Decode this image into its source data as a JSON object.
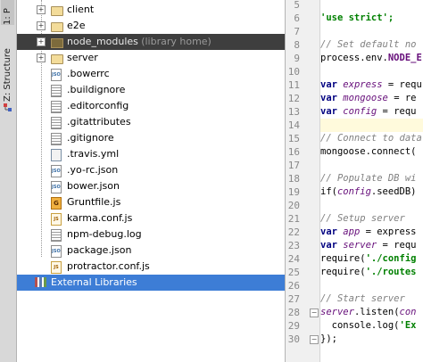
{
  "tool_strip": {
    "project_tab": "1: P",
    "structure_tab": "Z: Structure"
  },
  "tree": {
    "items": [
      {
        "label": "client",
        "kind": "folder",
        "expandable": true
      },
      {
        "label": "e2e",
        "kind": "folder",
        "expandable": true
      },
      {
        "label": "node_modules",
        "suffix": "(library home)",
        "kind": "folder-dark",
        "expandable": true
      },
      {
        "label": "server",
        "kind": "folder",
        "expandable": true
      },
      {
        "label": ".bowerrc",
        "kind": "json",
        "icon_text": "JSON"
      },
      {
        "label": ".buildignore",
        "kind": "text"
      },
      {
        "label": ".editorconfig",
        "kind": "text"
      },
      {
        "label": ".gitattributes",
        "kind": "text"
      },
      {
        "label": ".gitignore",
        "kind": "text"
      },
      {
        "label": ".travis.yml",
        "kind": "yml"
      },
      {
        "label": ".yo-rc.json",
        "kind": "json",
        "icon_text": "JSON"
      },
      {
        "label": "bower.json",
        "kind": "json",
        "icon_text": "JSON"
      },
      {
        "label": "Gruntfile.js",
        "kind": "grunt",
        "icon_text": "G"
      },
      {
        "label": "karma.conf.js",
        "kind": "js",
        "icon_text": "JS"
      },
      {
        "label": "npm-debug.log",
        "kind": "text"
      },
      {
        "label": "package.json",
        "kind": "json",
        "icon_text": "JSON"
      },
      {
        "label": "protractor.conf.js",
        "kind": "js",
        "icon_text": "JS"
      },
      {
        "label": "External Libraries",
        "kind": "libraries"
      }
    ]
  },
  "editor": {
    "line_numbers": [
      "5",
      "6",
      "7",
      "8",
      "9",
      "10",
      "11",
      "12",
      "13",
      "14",
      "15",
      "16",
      "17",
      "18",
      "19",
      "20",
      "21",
      "22",
      "23",
      "24",
      "25",
      "26",
      "27",
      "28",
      "29",
      "30"
    ],
    "current_line": "13",
    "code": {
      "l6": "'use strict';",
      "l8": "// Set default no",
      "l9_a": "process.env.",
      "l9_b": "NODE_E",
      "l11_kw": "var ",
      "l11_var": "express",
      "l11_rest": " = requ",
      "l12_kw": "var ",
      "l12_var": "mongoose",
      "l12_rest": " = re",
      "l13_kw": "var ",
      "l13_var": "config",
      "l13_rest": " = requ",
      "l15": "// Connect to data",
      "l16": "mongoose.connect(",
      "l18": "// Populate DB wi",
      "l19_a": "if(",
      "l19_b": "config",
      "l19_c": ".seedDB)",
      "l21": "// Setup server",
      "l22_kw": "var ",
      "l22_var": "app",
      "l22_rest": " = express",
      "l23_kw": "var ",
      "l23_var": "server",
      "l23_rest": " = requ",
      "l24_a": "require(",
      "l24_b": "'./config",
      "l25_a": "require(",
      "l25_b": "'./routes",
      "l27": "// Start server",
      "l28_a": "server",
      "l28_b": ".listen(",
      "l28_c": "con",
      "l29_a": "  console.log(",
      "l29_b": "'Ex",
      "l30": "});"
    }
  }
}
